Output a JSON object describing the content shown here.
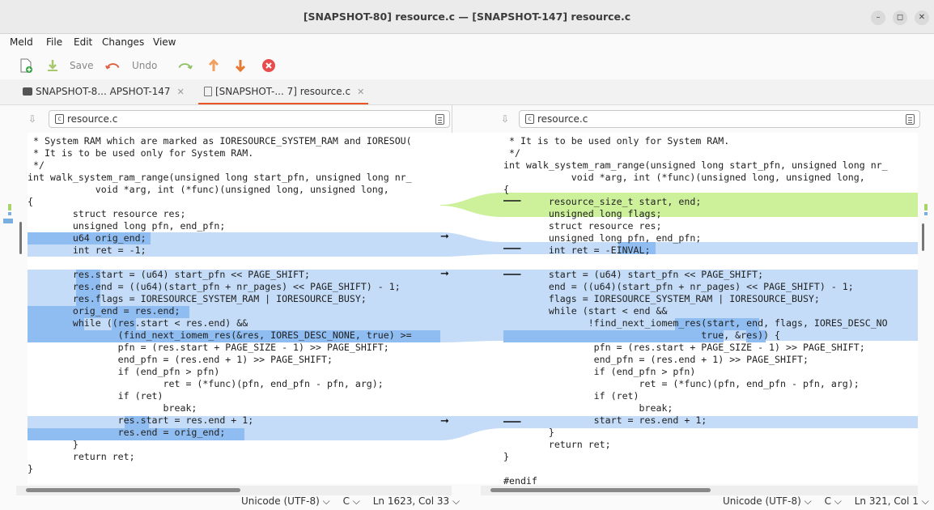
{
  "window": {
    "title": "[SNAPSHOT-80] resource.c — [SNAPSHOT-147] resource.c"
  },
  "menu": [
    "Meld",
    "File",
    "Edit",
    "Changes",
    "View"
  ],
  "toolbar": {
    "save_label": "Save",
    "undo_label": "Undo"
  },
  "tabs": [
    {
      "label": "SNAPSHOT-8... APSHOT-147",
      "icon": "folder-icon"
    },
    {
      "label": "[SNAPSHOT-... 7] resource.c",
      "icon": "file-icon"
    }
  ],
  "left": {
    "file": "resource.c",
    "lines": [
      " * System RAM which are marked as IORESOURCE_SYSTEM_RAM and IORESOU(",
      " * It is to be used only for System RAM.",
      " */",
      "int walk_system_ram_range(unsigned long start_pfn, unsigned long nr_",
      "            void *arg, int (*func)(unsigned long, unsigned long,",
      "{",
      "        struct resource res;",
      "        unsigned long pfn, end_pfn;",
      "        u64 orig_end;",
      "        int ret = -1;",
      "",
      "        res.start = (u64) start_pfn << PAGE_SHIFT;",
      "        res.end = ((u64)(start_pfn + nr_pages) << PAGE_SHIFT) - 1;",
      "        res.flags = IORESOURCE_SYSTEM_RAM | IORESOURCE_BUSY;",
      "        orig_end = res.end;",
      "        while ((res.start < res.end) &&",
      "                (find_next_iomem_res(&res, IORES_DESC_NONE, true) >=",
      "                pfn = (res.start + PAGE_SIZE - 1) >> PAGE_SHIFT;",
      "                end_pfn = (res.end + 1) >> PAGE_SHIFT;",
      "                if (end_pfn > pfn)",
      "                        ret = (*func)(pfn, end_pfn - pfn, arg);",
      "                if (ret)",
      "                        break;",
      "                res.start = res.end + 1;",
      "                res.end = orig_end;",
      "        }",
      "        return ret;",
      "}"
    ]
  },
  "right": {
    "file": "resource.c",
    "lines": [
      " * It is to be used only for System RAM.",
      " */",
      "int walk_system_ram_range(unsigned long start_pfn, unsigned long nr_",
      "            void *arg, int (*func)(unsigned long, unsigned long,",
      "{",
      "        resource_size_t start, end;",
      "        unsigned long flags;",
      "        struct resource res;",
      "        unsigned long pfn, end_pfn;",
      "        int ret = -EINVAL;",
      "",
      "        start = (u64) start_pfn << PAGE_SHIFT;",
      "        end = ((u64)(start_pfn + nr_pages) << PAGE_SHIFT) - 1;",
      "        flags = IORESOURCE_SYSTEM_RAM | IORESOURCE_BUSY;",
      "        while (start < end &&",
      "               !find_next_iomem_res(start, end, flags, IORES_DESC_NO",
      "                                   true, &res)) {",
      "                pfn = (res.start + PAGE_SIZE - 1) >> PAGE_SHIFT;",
      "                end_pfn = (res.end + 1) >> PAGE_SHIFT;",
      "                if (end_pfn > pfn)",
      "                        ret = (*func)(pfn, end_pfn - pfn, arg);",
      "                if (ret)",
      "                        break;",
      "                start = res.end + 1;",
      "        }",
      "        return ret;",
      "}",
      "",
      "#endif"
    ]
  },
  "status_left": {
    "encoding": "Unicode (UTF-8)",
    "language": "C",
    "position": "Ln 1623, Col 33"
  },
  "status_right": {
    "encoding": "Unicode (UTF-8)",
    "language": "C",
    "position": "Ln 321, Col 1"
  },
  "colors": {
    "accent": "#e95420",
    "changed": "#c4dcf7",
    "inserted": "#cdf09a",
    "inline_highlight": "#8fbdf1"
  }
}
